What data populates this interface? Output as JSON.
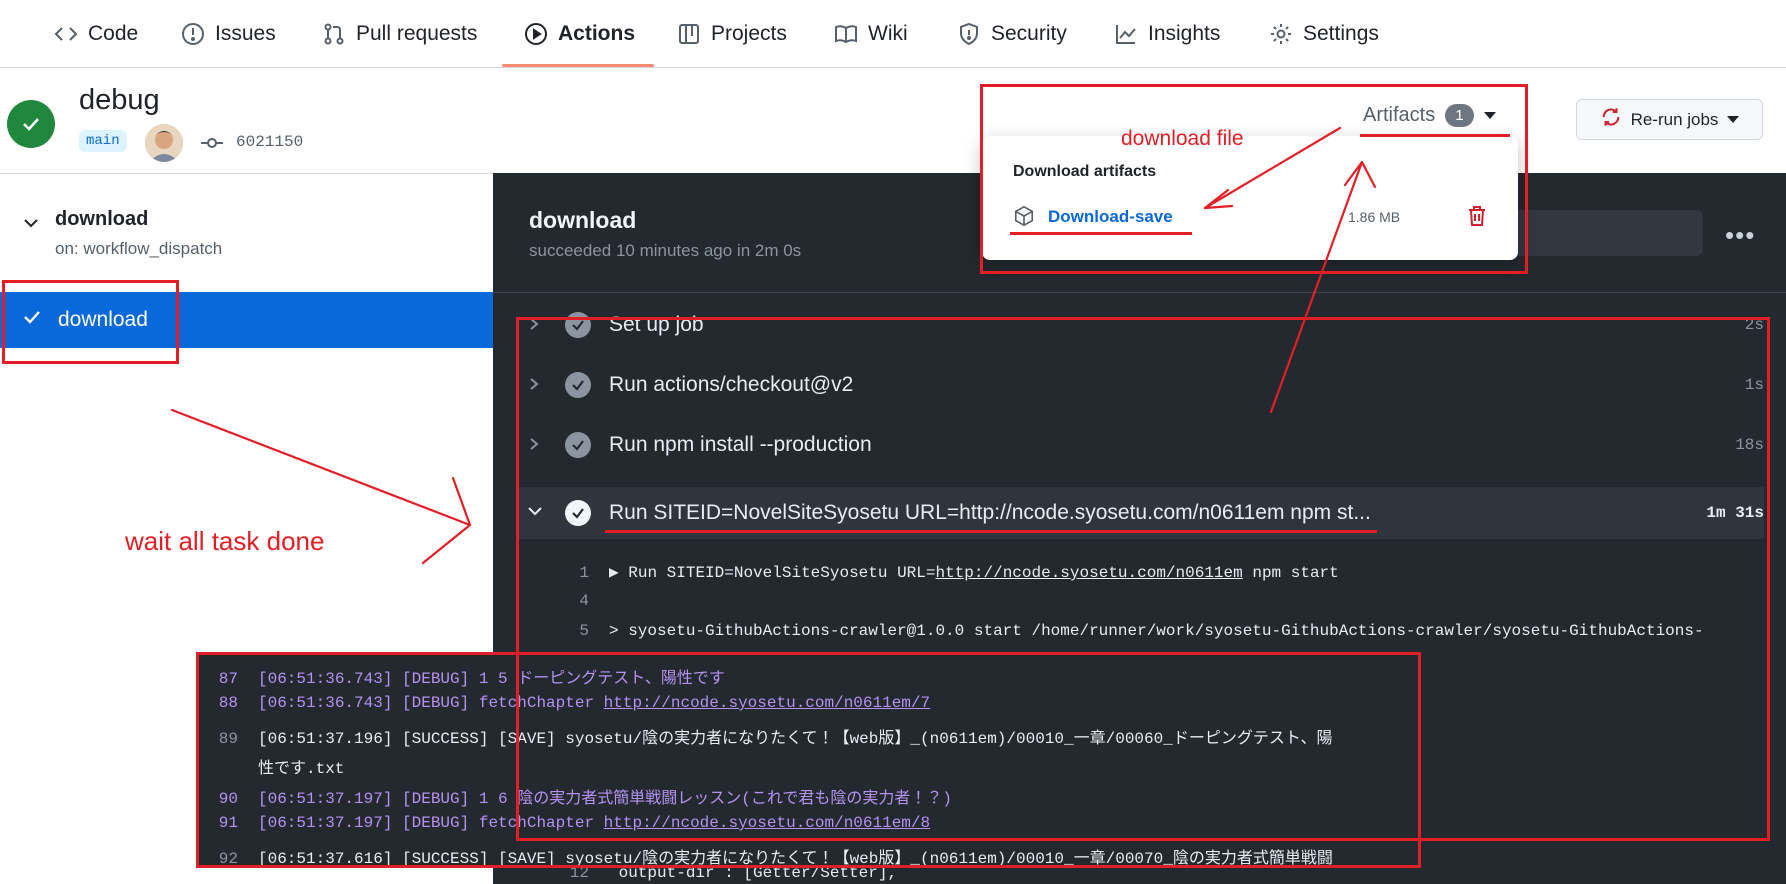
{
  "nav": {
    "tabs": [
      {
        "label": "Code",
        "icon": "code-icon"
      },
      {
        "label": "Issues",
        "icon": "issue-opened-icon"
      },
      {
        "label": "Pull requests",
        "icon": "git-pull-request-icon"
      },
      {
        "label": "Actions",
        "icon": "play-icon",
        "active": true
      },
      {
        "label": "Projects",
        "icon": "table-icon"
      },
      {
        "label": "Wiki",
        "icon": "book-icon"
      },
      {
        "label": "Security",
        "icon": "shield-icon"
      },
      {
        "label": "Insights",
        "icon": "graph-icon"
      },
      {
        "label": "Settings",
        "icon": "gear-icon"
      }
    ],
    "active_color": "#fd8c73"
  },
  "run": {
    "title": "debug",
    "branch": "main",
    "commit": "6021150",
    "status": "success",
    "status_color": "#1f883d"
  },
  "artifacts": {
    "label": "Artifacts",
    "count": "1",
    "dropdown_title": "Download artifacts",
    "items": [
      {
        "name": "Download-save",
        "size": "1.86 MB"
      }
    ]
  },
  "rerun": {
    "label": "Re-run jobs"
  },
  "sidebar": {
    "workflow": {
      "name": "download",
      "trigger": "on: workflow_dispatch"
    },
    "jobs": [
      {
        "label": "download",
        "selected": true
      }
    ],
    "selected_color": "#0969da"
  },
  "job": {
    "title": "download",
    "subtitle": "succeeded 10 minutes ago in 2m 0s",
    "steps": [
      {
        "label": "Set up job",
        "duration": "2s"
      },
      {
        "label": "Run actions/checkout@v2",
        "duration": "1s"
      },
      {
        "label": "Run npm install --production",
        "duration": "18s"
      },
      {
        "label": "Run SITEID=NovelSiteSyosetu URL=http://ncode.syosetu.com/n0611em npm st...",
        "duration": "1m 31s",
        "expanded": true
      }
    ],
    "log": [
      {
        "num": "1",
        "pre": "▶ Run SITEID=NovelSiteSyosetu  URL=",
        "link": "http://ncode.syosetu.com/n0611em",
        "post": " npm start"
      },
      {
        "num": "4",
        "pre": "",
        "link": "",
        "post": ""
      },
      {
        "num": "5",
        "pre": "> syosetu-GithubActions-crawler@1.0.0 start /home/runner/work/syosetu-GithubActions-crawler/syosetu-GithubActions-",
        "link": "",
        "post": ""
      },
      {
        "num": "12",
        "pre": "      output-dir : [Getter/Setter],",
        "link": "",
        "post": ""
      }
    ]
  },
  "overlay_log": [
    {
      "num": "87",
      "type": "debug",
      "pre": "[06:51:36.743] [DEBUG] 1 5 ドーピングテスト、陽性です",
      "link": "",
      "post": ""
    },
    {
      "num": "88",
      "type": "debug",
      "pre": "[06:51:36.743] [DEBUG] fetchChapter ",
      "link": "http://ncode.syosetu.com/n0611em/7",
      "post": ""
    },
    {
      "num": "89",
      "type": "success",
      "pre": "[06:51:37.196] [SUCCESS] [SAVE] syosetu/陰の実力者になりたくて！【web版】_(n0611em)/00010_一章/00060_ドーピングテスト、陽",
      "link": "",
      "post": ""
    },
    {
      "num": "",
      "type": "success",
      "pre": "性です.txt",
      "link": "",
      "post": ""
    },
    {
      "num": "90",
      "type": "debug",
      "pre": "[06:51:37.197] [DEBUG] 1 6 陰の実力者式簡単戦闘レッスン(これで君も陰の実力者！？)",
      "link": "",
      "post": ""
    },
    {
      "num": "91",
      "type": "debug",
      "pre": "[06:51:37.197] [DEBUG] fetchChapter ",
      "link": "http://ncode.syosetu.com/n0611em/8",
      "post": ""
    },
    {
      "num": "92",
      "type": "success",
      "pre": "[06:51:37.616] [SUCCESS] [SAVE] syosetu/陰の実力者になりたくて！【web版】_(n0611em)/00010_一章/00070_陰の実力者式簡単戦闘",
      "link": "",
      "post": ""
    }
  ],
  "annotations": {
    "download_file": "download file",
    "wait_all_task_done": "wait all task done",
    "color": "#e31e25"
  }
}
